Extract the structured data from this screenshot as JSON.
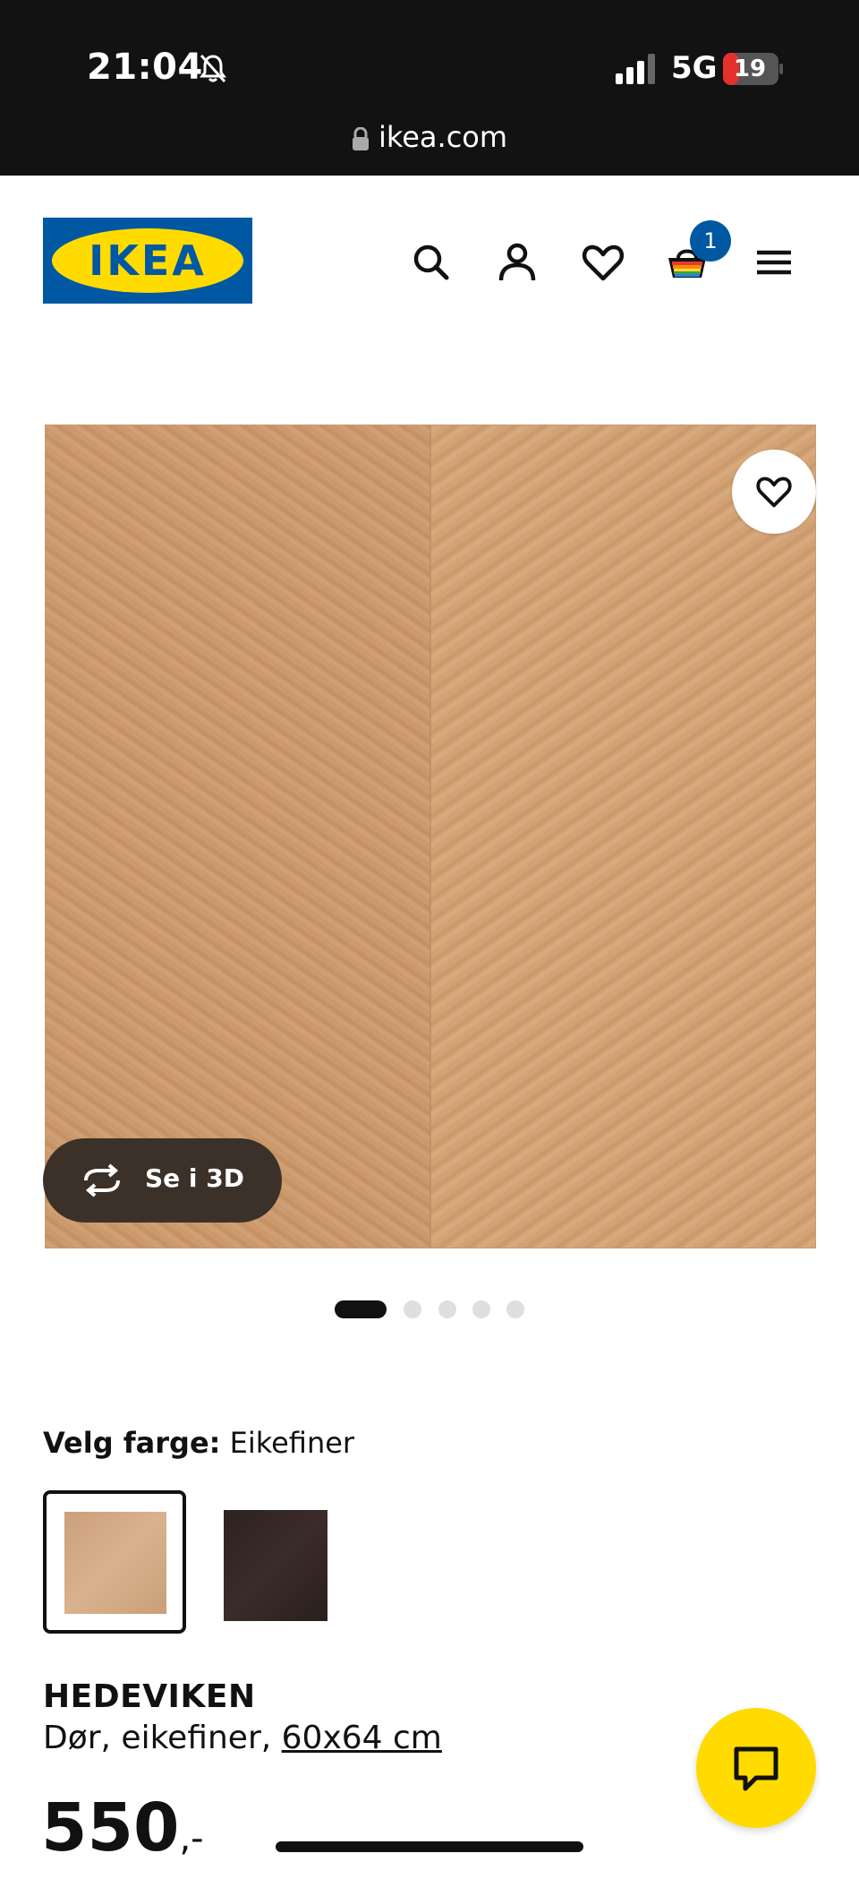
{
  "status_bar": {
    "time": "21:04",
    "network": "5G",
    "battery": "19"
  },
  "browser": {
    "url": "ikea.com"
  },
  "header": {
    "logo_text": "IKEA",
    "cart_count": "1",
    "icons": [
      "search-icon",
      "account-icon",
      "heart-icon",
      "cart-icon",
      "menu-icon"
    ]
  },
  "gallery": {
    "view_3d_label": "Se i 3D",
    "dots_total": 5,
    "active_dot": 1
  },
  "color_select": {
    "label": "Velg farge:",
    "value": "Eikefiner",
    "swatches": [
      "oak-veneer",
      "dark-brown"
    ]
  },
  "product": {
    "name": "HEDEVIKEN",
    "description": "Dør, eikefiner,",
    "size": "60x64 cm",
    "price": "550",
    "price_suffix": ",-"
  },
  "colors": {
    "ikea_blue": "#0058a3",
    "ikea_yellow": "#ffdb00"
  }
}
